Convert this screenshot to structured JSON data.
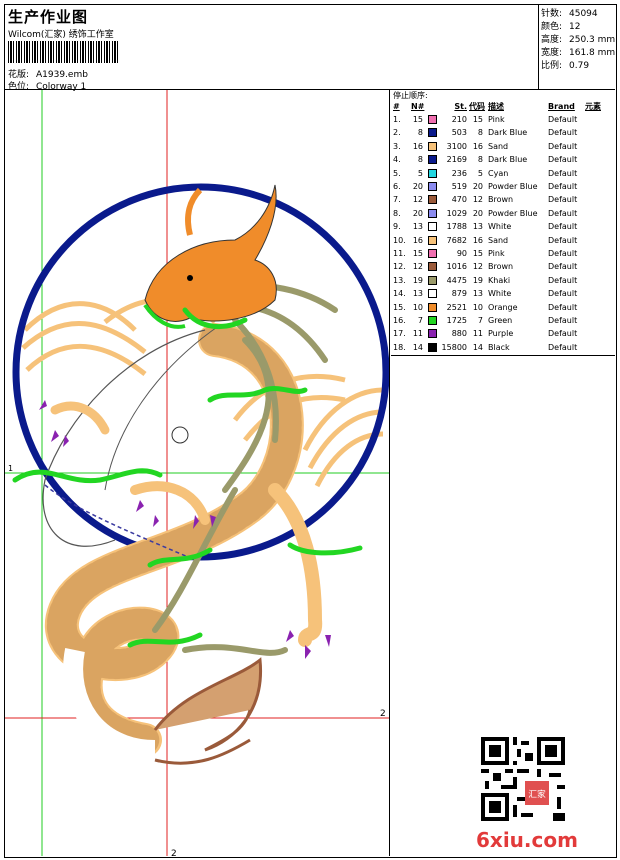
{
  "header": {
    "title": "生产作业图",
    "company": "Wilcom(汇家) 绣饰工作室",
    "design_label": "花版:",
    "design_value": "A1939.emb",
    "colorway_label": "色位:",
    "colorway_value": "Colorway 1"
  },
  "stats": [
    {
      "label": "针数:",
      "value": "45094"
    },
    {
      "label": "颜色:",
      "value": "12"
    },
    {
      "label": "高度:",
      "value": "250.3 mm"
    },
    {
      "label": "宽度:",
      "value": "161.8 mm"
    },
    {
      "label": "比例:",
      "value": "0.79"
    }
  ],
  "legend": {
    "caption": "停止顺序:",
    "headers": {
      "idx": "#",
      "nn": "N#",
      "st": "St.",
      "code": "代码",
      "desc": "描述",
      "brand": "Brand",
      "element": "元素"
    },
    "rows": [
      {
        "idx": "1.",
        "nn": "15",
        "color": "#f06fb0",
        "st": "210",
        "code": "15",
        "desc": "Pink",
        "brand": "Default"
      },
      {
        "idx": "2.",
        "nn": "8",
        "color": "#0a1a8c",
        "st": "503",
        "code": "8",
        "desc": "Dark Blue",
        "brand": "Default"
      },
      {
        "idx": "3.",
        "nn": "16",
        "color": "#f6c27a",
        "st": "3100",
        "code": "16",
        "desc": "Sand",
        "brand": "Default"
      },
      {
        "idx": "4.",
        "nn": "8",
        "color": "#0a1a8c",
        "st": "2169",
        "code": "8",
        "desc": "Dark Blue",
        "brand": "Default"
      },
      {
        "idx": "5.",
        "nn": "5",
        "color": "#22d6e0",
        "st": "236",
        "code": "5",
        "desc": "Cyan",
        "brand": "Default"
      },
      {
        "idx": "6.",
        "nn": "20",
        "color": "#8c8cf0",
        "st": "519",
        "code": "20",
        "desc": "Powder Blue",
        "brand": "Default"
      },
      {
        "idx": "7.",
        "nn": "12",
        "color": "#9a5a3a",
        "st": "470",
        "code": "12",
        "desc": "Brown",
        "brand": "Default"
      },
      {
        "idx": "8.",
        "nn": "20",
        "color": "#8c8cf0",
        "st": "1029",
        "code": "20",
        "desc": "Powder Blue",
        "brand": "Default"
      },
      {
        "idx": "9.",
        "nn": "13",
        "color": "#ffffff",
        "st": "1788",
        "code": "13",
        "desc": "White",
        "brand": "Default"
      },
      {
        "idx": "10.",
        "nn": "16",
        "color": "#f6c27a",
        "st": "7682",
        "code": "16",
        "desc": "Sand",
        "brand": "Default"
      },
      {
        "idx": "11.",
        "nn": "15",
        "color": "#f06fb0",
        "st": "90",
        "code": "15",
        "desc": "Pink",
        "brand": "Default"
      },
      {
        "idx": "12.",
        "nn": "12",
        "color": "#9a5a3a",
        "st": "1016",
        "code": "12",
        "desc": "Brown",
        "brand": "Default"
      },
      {
        "idx": "13.",
        "nn": "19",
        "color": "#9a9a6a",
        "st": "4475",
        "code": "19",
        "desc": "Khaki",
        "brand": "Default"
      },
      {
        "idx": "14.",
        "nn": "13",
        "color": "#ffffff",
        "st": "879",
        "code": "13",
        "desc": "White",
        "brand": "Default"
      },
      {
        "idx": "15.",
        "nn": "10",
        "color": "#f08c2a",
        "st": "2521",
        "code": "10",
        "desc": "Orange",
        "brand": "Default"
      },
      {
        "idx": "16.",
        "nn": "7",
        "color": "#22d622",
        "st": "1725",
        "code": "7",
        "desc": "Green",
        "brand": "Default"
      },
      {
        "idx": "17.",
        "nn": "11",
        "color": "#8a22b0",
        "st": "880",
        "code": "11",
        "desc": "Purple",
        "brand": "Default"
      },
      {
        "idx": "18.",
        "nn": "14",
        "color": "#000000",
        "st": "15800",
        "code": "14",
        "desc": "Black",
        "brand": "Default"
      }
    ]
  },
  "guides": {
    "marker_right": "2",
    "marker_bottom": "2",
    "marker_left": "1"
  },
  "watermark": {
    "logo_text": "6xiu.com",
    "seal_text": "汇家"
  }
}
